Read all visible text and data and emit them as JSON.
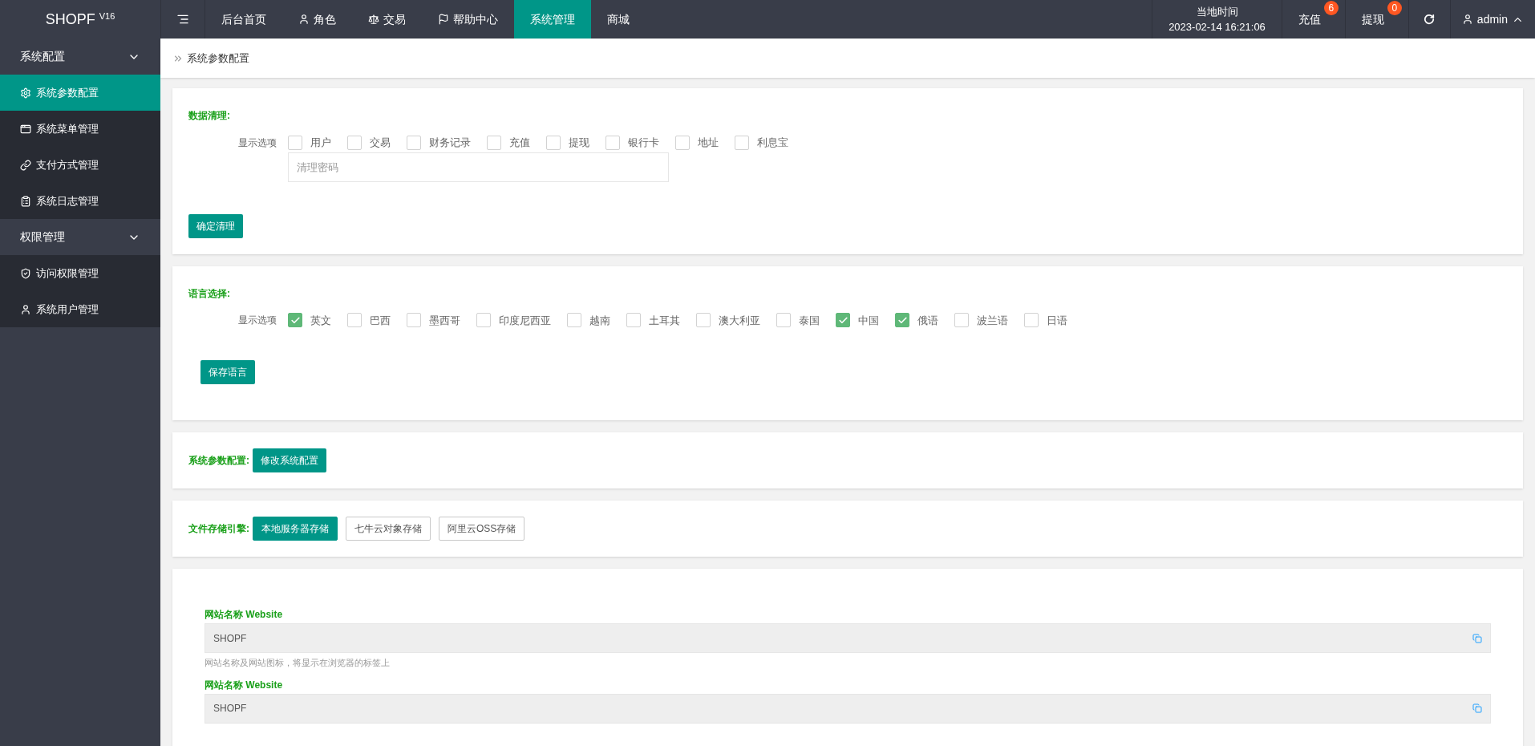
{
  "logo": {
    "name": "SHOPF",
    "version": "V16"
  },
  "nav": [
    {
      "label": "后台首页",
      "selected": false
    },
    {
      "label": "角色",
      "selected": false
    },
    {
      "label": "交易",
      "selected": false
    },
    {
      "label": "帮助中心",
      "selected": false
    },
    {
      "label": "系统管理",
      "selected": true
    },
    {
      "label": "商城",
      "selected": false
    }
  ],
  "clock": {
    "label": "当地时间",
    "time": "2023-02-14 16:21:06"
  },
  "counters": [
    {
      "label": "充值",
      "badge": "6"
    },
    {
      "label": "提现",
      "badge": "0"
    }
  ],
  "user": {
    "name": "admin"
  },
  "sidebar": [
    {
      "label": "系统配置",
      "expanded": true,
      "children": [
        {
          "label": "系统参数配置",
          "selected": true
        },
        {
          "label": "系统菜单管理",
          "selected": false
        },
        {
          "label": "支付方式管理",
          "selected": false
        },
        {
          "label": "系统日志管理",
          "selected": false
        }
      ]
    },
    {
      "label": "权限管理",
      "expanded": true,
      "children": [
        {
          "label": "访问权限管理",
          "selected": false
        },
        {
          "label": "系统用户管理",
          "selected": false
        }
      ]
    }
  ],
  "breadcrumb": "系统参数配置",
  "data_clean": {
    "title": "数据清理:",
    "options_label": "显示选项",
    "options": [
      {
        "label": "用户",
        "checked": false
      },
      {
        "label": "交易",
        "checked": false
      },
      {
        "label": "财务记录",
        "checked": false
      },
      {
        "label": "充值",
        "checked": false
      },
      {
        "label": "提现",
        "checked": false
      },
      {
        "label": "银行卡",
        "checked": false
      },
      {
        "label": "地址",
        "checked": false
      },
      {
        "label": "利息宝",
        "checked": false
      }
    ],
    "password_placeholder": "清理密码",
    "button": "确定清理"
  },
  "language": {
    "title": "语言选择:",
    "options_label": "显示选项",
    "options": [
      {
        "label": "英文",
        "checked": true
      },
      {
        "label": "巴西",
        "checked": false
      },
      {
        "label": "墨西哥",
        "checked": false
      },
      {
        "label": "印度尼西亚",
        "checked": false
      },
      {
        "label": "越南",
        "checked": false
      },
      {
        "label": "土耳其",
        "checked": false
      },
      {
        "label": "澳大利亚",
        "checked": false
      },
      {
        "label": "泰国",
        "checked": false
      },
      {
        "label": "中国",
        "checked": true
      },
      {
        "label": "俄语",
        "checked": true
      },
      {
        "label": "波兰语",
        "checked": false
      },
      {
        "label": "日语",
        "checked": false
      }
    ],
    "button": "保存语言"
  },
  "system_config": {
    "title": "系统参数配置:",
    "button": "修改系统配置"
  },
  "storage": {
    "title": "文件存储引擎:",
    "options": [
      {
        "label": "本地服务器存储",
        "selected": true
      },
      {
        "label": "七牛云对象存储",
        "selected": false
      },
      {
        "label": "阿里云OSS存储",
        "selected": false
      }
    ]
  },
  "website_fields": [
    {
      "label": "网站名称 Website",
      "value": "SHOPF",
      "hint": "网站名称及网站图标，将显示在浏览器的标签上"
    },
    {
      "label": "网站名称 Website",
      "value": "SHOPF"
    }
  ]
}
